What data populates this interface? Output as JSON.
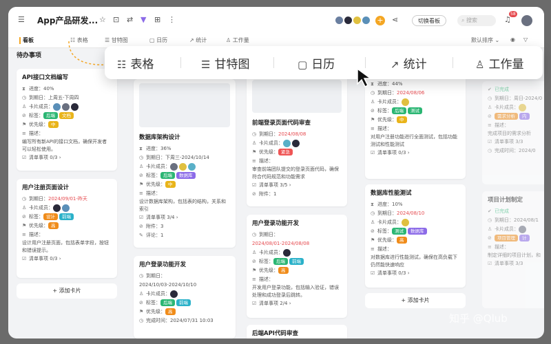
{
  "app": {
    "title": "App产品研发...",
    "switch_board": "切换看板",
    "search_placeholder": "搜索",
    "notif_count": "58"
  },
  "tabs": [
    "看板",
    "表格",
    "甘特图",
    "日历",
    "统计",
    "工作量"
  ],
  "sort": "默认排序",
  "floatbar": [
    "表格",
    "甘特图",
    "日历",
    "统计",
    "工作量"
  ],
  "columns": {
    "todo": "待办事项"
  },
  "labels": {
    "progress": "进度：",
    "due": "到期日：",
    "members": "卡片成员：",
    "tags": "标签：",
    "priority": "优先级：",
    "desc": "描述：",
    "checklist": "清单事项 ",
    "attach": "附件：",
    "comments": "评论：",
    "done_time": "完成时间：",
    "add_card": "+ 添加卡片"
  },
  "cards": {
    "c1": {
      "title": "API接口文档编写",
      "progress": "40%",
      "due": "上周五-下周四",
      "tags": [
        "后端",
        "文档"
      ],
      "priority": "中",
      "desc": "编写所有新API的接口文档，确保开发者可以轻松使用。",
      "check": "0/3"
    },
    "c2": {
      "title": "用户注册页面设计",
      "due": "2024/09/01-昨天",
      "tags": [
        "设计",
        "前端"
      ],
      "priority": "高",
      "desc": "设计用户注册页面，包括表单字段，按钮和错误提示。",
      "check": "0/3"
    },
    "c3": {
      "title": "数据库架构设计",
      "progress": "36%",
      "due": "下周三-2024/10/14",
      "tags": [
        "后端",
        "数据库"
      ],
      "priority": "中",
      "desc": "设计数据库架构，包括表的结构，关系和索引",
      "check": "3/4",
      "attach": "3",
      "comments": "1"
    },
    "c4": {
      "title": "用户登录功能开发",
      "due": "2024/10/03-2024/10/10",
      "tags": [
        "后端",
        "前端"
      ],
      "priority": "高",
      "done": "2024/07/31 10:03"
    },
    "c5": {
      "title": "前端登录页面代码审查",
      "due": "2024/08/08",
      "priority": "紧急",
      "desc": "审查前端团队提交的登录页面代码，确保符合代码规范和功能需求",
      "check": "3/5",
      "attach": "1"
    },
    "c6": {
      "title": "用户登录功能开发",
      "due": "2024/08/01-2024/08/08",
      "tags": [
        "后端",
        "前端"
      ],
      "priority": "高",
      "desc": "开发用户登录功能，包括输入验证，错误处理和成功登录后跳转。",
      "check": "2/4"
    },
    "c7": {
      "title": "后端API代码审查"
    },
    "c8": {
      "progress": "44%",
      "due": "2024/08/06",
      "tags": [
        "后端",
        "测试"
      ],
      "priority": "中",
      "desc": "对用户注册功能进行全面测试，包括功能测试和性能测试",
      "check": "0/3"
    },
    "c9": {
      "title": "数据库性能测试",
      "progress": "10%",
      "due": "2024/08/10",
      "tags": [
        "测试",
        "数据库"
      ],
      "priority": "高",
      "desc": "对数据库进行性能测试，确保在高负载下仍然能快速响应",
      "check": "0/3"
    },
    "c10": {
      "status": "已完成",
      "due": "周日-2024/0",
      "tags": [
        "需求分析",
        "内"
      ],
      "desc": "完成项目的需求分析",
      "check": "3/3",
      "done": "2024/0"
    },
    "c11": {
      "title": "项目计划制定",
      "status": "已完成",
      "due": "2024/08/1",
      "tags": [
        "项目管理",
        "计"
      ],
      "desc": "制定详细的项目计划，和",
      "check": "3/3"
    }
  },
  "icons": {
    "menu": "menu-icon",
    "star": "star-icon",
    "lock": "lock-icon",
    "plus": "plus-icon"
  },
  "watermark": "知乎 @Qlub"
}
